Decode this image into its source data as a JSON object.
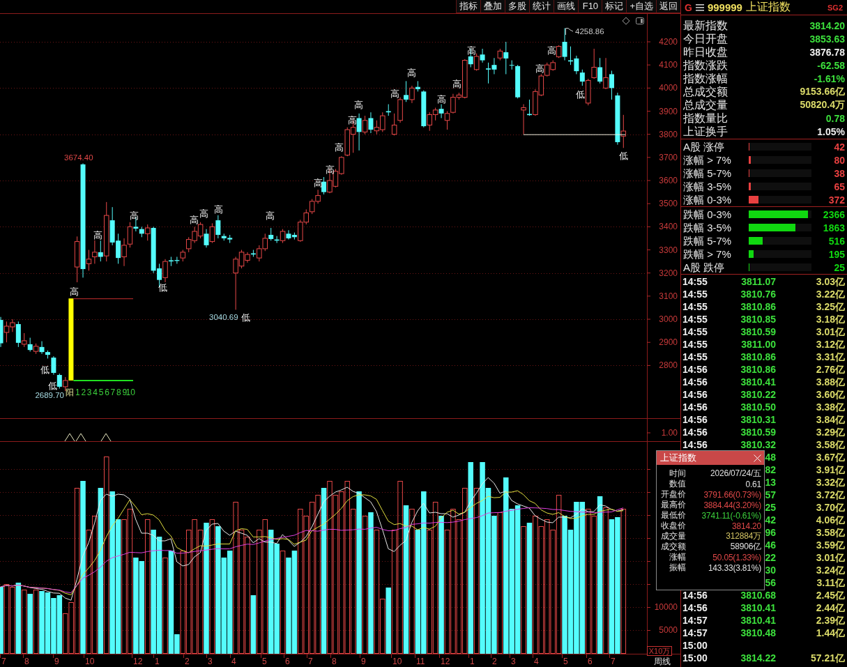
{
  "toolbar": {
    "buttons": [
      "指标",
      "叠加",
      "多股",
      "统计",
      "画线",
      "F10",
      "标记",
      "+自选",
      "返回"
    ]
  },
  "chart": {
    "price_ticks": [
      "4200",
      "4100",
      "4000",
      "3900",
      "3800",
      "3700",
      "3600",
      "3500",
      "3400",
      "3300",
      "3200",
      "3100",
      "3000",
      "2900",
      "2800"
    ],
    "price_labels": [
      {
        "text": "3674.40",
        "color": "#e04848"
      },
      {
        "text": "4258.86",
        "color": "#c8c8c8"
      },
      {
        "text": "3040.69",
        "color": "#a8dce4"
      },
      {
        "text": "2689.70",
        "color": "#a8dce4"
      }
    ],
    "markers": [
      {
        "kind": "low",
        "text": "低"
      },
      {
        "kind": "low",
        "text": "低"
      },
      {
        "kind": "high",
        "text": "高"
      },
      {
        "kind": "high",
        "text": "高"
      },
      {
        "kind": "high",
        "text": "高"
      },
      {
        "kind": "low",
        "text": "低"
      },
      {
        "kind": "high",
        "text": "高"
      },
      {
        "kind": "high",
        "text": "高"
      },
      {
        "kind": "high",
        "text": "高"
      },
      {
        "kind": "low",
        "text": "低"
      },
      {
        "kind": "high",
        "text": "高"
      },
      {
        "kind": "high",
        "text": "高"
      },
      {
        "kind": "high",
        "text": "高"
      },
      {
        "kind": "high",
        "text": "高"
      },
      {
        "kind": "high",
        "text": "高"
      },
      {
        "kind": "high",
        "text": "高"
      },
      {
        "kind": "high",
        "text": "高"
      },
      {
        "kind": "high",
        "text": "高"
      },
      {
        "kind": "high",
        "text": "高"
      },
      {
        "kind": "high",
        "text": "高"
      },
      {
        "kind": "high",
        "text": "高"
      },
      {
        "kind": "high",
        "text": "高"
      },
      {
        "kind": "high",
        "text": "高"
      },
      {
        "kind": "low",
        "text": "低"
      },
      {
        "kind": "low",
        "text": "低"
      }
    ],
    "candle_tag": "阳",
    "week_counts": [
      "1",
      "2",
      "3",
      "4",
      "5",
      "6",
      "7",
      "8",
      "9",
      "10"
    ],
    "indicator_tick": "1.00",
    "volume_ticks": [
      "10000",
      "5000"
    ],
    "volume_unit": "X10万",
    "months": [
      "7",
      "8",
      "9",
      "10",
      "12",
      "1",
      "2",
      "3",
      "4",
      "5",
      "6",
      "7",
      "8",
      "9",
      "10",
      "11",
      "12",
      "1",
      "2",
      "3",
      "4",
      "5",
      "6",
      "7"
    ],
    "period": "周线"
  },
  "quote": {
    "market": "G",
    "code": "999999",
    "name": "上证指数",
    "tag": "SG2",
    "stats": [
      {
        "label": "最新指数",
        "value": "3814.20",
        "color": "#3ce03c"
      },
      {
        "label": "今日开盘",
        "value": "3853.63",
        "color": "#3ce03c"
      },
      {
        "label": "昨日收盘",
        "value": "3876.78",
        "color": "#f0f0f0"
      },
      {
        "label": "指数涨跌",
        "value": "-62.58",
        "color": "#3ce03c"
      },
      {
        "label": "指数涨幅",
        "value": "-1.61%",
        "color": "#3ce03c"
      },
      {
        "label": "总成交额",
        "value": "9153.66亿",
        "color": "#dcdc6a"
      },
      {
        "label": "总成交量",
        "value": "50820.4万",
        "color": "#dcdc6a"
      },
      {
        "label": "指数量比",
        "value": "0.78",
        "color": "#3ce03c"
      },
      {
        "label": "上证换手",
        "value": "1.05%",
        "color": "#f0f0f0"
      }
    ],
    "advance_breadth": [
      {
        "label": "A股 涨停",
        "count": "42",
        "level": 0.01,
        "color": "#e84040"
      },
      {
        "label": "涨幅 > 7%",
        "count": "80",
        "level": 0.03,
        "color": "#e84040"
      },
      {
        "label": "涨幅 5-7%",
        "count": "38",
        "level": 0.01,
        "color": "#e84040"
      },
      {
        "label": "涨幅 3-5%",
        "count": "65",
        "level": 0.03,
        "color": "#e84040"
      },
      {
        "label": "涨幅 0-3%",
        "count": "372",
        "level": 0.16,
        "color": "#e84040"
      }
    ],
    "decline_breadth": [
      {
        "label": "跌幅 0-3%",
        "count": "2366",
        "level": 0.94,
        "color": "#10d810"
      },
      {
        "label": "跌幅 3-5%",
        "count": "1863",
        "level": 0.74,
        "color": "#10d810"
      },
      {
        "label": "跌幅 5-7%",
        "count": "516",
        "level": 0.22,
        "color": "#10d810"
      },
      {
        "label": "跌幅 > 7%",
        "count": "195",
        "level": 0.08,
        "color": "#10d810"
      },
      {
        "label": "A股 跌停",
        "count": "25",
        "level": 0.01,
        "color": "#10d810"
      }
    ],
    "trades": [
      {
        "time": "14:55",
        "price": "3811.07",
        "amount": "3.03亿"
      },
      {
        "time": "14:55",
        "price": "3810.76",
        "amount": "3.22亿"
      },
      {
        "time": "14:55",
        "price": "3810.86",
        "amount": "3.25亿"
      },
      {
        "time": "14:55",
        "price": "3810.85",
        "amount": "3.18亿"
      },
      {
        "time": "14:55",
        "price": "3810.59",
        "amount": "3.01亿"
      },
      {
        "time": "14:55",
        "price": "3811.00",
        "amount": "3.12亿"
      },
      {
        "time": "14:55",
        "price": "3810.86",
        "amount": "3.31亿"
      },
      {
        "time": "14:56",
        "price": "3810.86",
        "amount": "2.76亿"
      },
      {
        "time": "14:56",
        "price": "3810.41",
        "amount": "3.88亿"
      },
      {
        "time": "14:56",
        "price": "3810.22",
        "amount": "3.60亿"
      },
      {
        "time": "14:56",
        "price": "3810.50",
        "amount": "3.38亿"
      },
      {
        "time": "14:56",
        "price": "3810.31",
        "amount": "3.84亿"
      },
      {
        "time": "14:56",
        "price": "3810.59",
        "amount": "3.29亿"
      },
      {
        "time": "14:56",
        "price": "3810.32",
        "amount": "3.58亿"
      },
      {
        "price": "48",
        "amount": "3.67亿"
      },
      {
        "price": "82",
        "amount": "3.91亿"
      },
      {
        "price": "13",
        "amount": "3.32亿"
      },
      {
        "price": "57",
        "amount": "3.72亿"
      },
      {
        "price": "25",
        "amount": "3.70亿"
      },
      {
        "price": "42",
        "amount": "4.06亿"
      },
      {
        "price": "96",
        "amount": "3.58亿"
      },
      {
        "price": "46",
        "amount": "3.59亿"
      },
      {
        "price": "22",
        "amount": "3.01亿"
      },
      {
        "price": "30",
        "amount": "3.24亿"
      },
      {
        "price": "56",
        "amount": "3.11亿"
      },
      {
        "time": "14:56",
        "price": "3810.68",
        "amount": "2.45亿"
      },
      {
        "time": "14:56",
        "price": "3810.41",
        "amount": "2.44亿"
      },
      {
        "time": "14:57",
        "price": "3810.41",
        "amount": "2.39亿"
      },
      {
        "time": "14:57",
        "price": "3810.48",
        "amount": "1.44亿"
      },
      {
        "time": "15:00"
      },
      {
        "time": "15:00",
        "price": "3814.22",
        "amount": "57.21亿"
      }
    ]
  },
  "popup": {
    "title": "上证指数",
    "rows": [
      {
        "label": "时间",
        "value": "2026/07/24/五",
        "color": "#e0e0e0"
      },
      {
        "label": "数值",
        "value": "0.61",
        "color": "#e0e0e0"
      },
      {
        "label": "开盘价",
        "value": "3791.66(0.73%)",
        "color": "#e04848"
      },
      {
        "label": "最高价",
        "value": "3884.44(3.20%)",
        "color": "#e04848"
      },
      {
        "label": "最低价",
        "value": "3741.11(-0.61%)",
        "color": "#3cd03c"
      },
      {
        "label": "收盘价",
        "value": "3814.20",
        "color": "#e04848"
      },
      {
        "label": "成交量",
        "value": "312884万",
        "color": "#d4c464"
      },
      {
        "label": "成交额",
        "value": "58906亿",
        "color": "#e0e0e0"
      },
      {
        "label": "涨幅",
        "value": "50.05(1.33%)",
        "color": "#e04848"
      },
      {
        "label": "振幅",
        "value": "143.33(3.81%)",
        "color": "#e0e0e0"
      }
    ]
  }
}
